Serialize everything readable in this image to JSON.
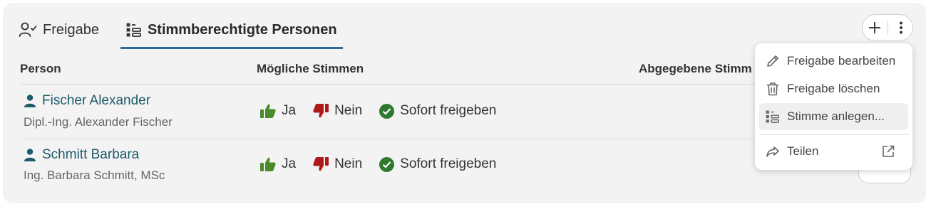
{
  "tabs": [
    {
      "label": "Freigabe",
      "icon": "user-check-icon"
    },
    {
      "label": "Stimmberechtigte Personen",
      "icon": "list-icon",
      "active": true
    }
  ],
  "toolbar": {
    "add_icon": "plus-icon",
    "more_icon": "more-vertical-icon"
  },
  "table": {
    "headers": [
      "Person",
      "Mögliche Stimmen",
      "Abgegebene Stimm"
    ],
    "rows": [
      {
        "name": "Fischer Alexander",
        "title": "Dipl.-Ing. Alexander Fischer",
        "votes": [
          "Ja",
          "Nein",
          "Sofort freigeben"
        ]
      },
      {
        "name": "Schmitt Barbara",
        "title": "Ing. Barbara Schmitt, MSc",
        "votes": [
          "Ja",
          "Nein",
          "Sofort freigeben"
        ]
      }
    ]
  },
  "menu": {
    "items": [
      {
        "label": "Freigabe bearbeiten",
        "icon": "pencil-icon"
      },
      {
        "label": "Freigabe löschen",
        "icon": "trash-icon"
      },
      {
        "label": "Stimme anlegen...",
        "icon": "list-add-icon",
        "highlighted": true
      },
      {
        "label": "Teilen",
        "icon": "share-icon",
        "trailing_icon": "external-link-icon"
      }
    ]
  },
  "colors": {
    "accent": "#2c6a99",
    "yes": "#4a8a2a",
    "no": "#b01818",
    "approve": "#2f7a2f",
    "person": "#1d5a6a"
  }
}
